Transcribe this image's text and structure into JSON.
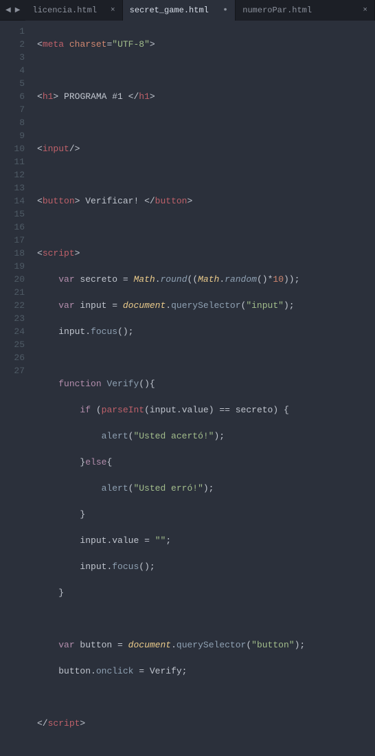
{
  "tabs": [
    {
      "label": "licencia.html",
      "close": "×",
      "active": false,
      "dirty": false
    },
    {
      "label": "secret_game.html",
      "close": "•",
      "active": true,
      "dirty": true
    },
    {
      "label": "numeroPar.html",
      "close": "×",
      "active": false,
      "dirty": false
    }
  ],
  "nav": {
    "back": "◀",
    "forward": "▶",
    "overflow": "⌄"
  },
  "gutter": [
    "1",
    "2",
    "3",
    "4",
    "5",
    "6",
    "7",
    "8",
    "9",
    "10",
    "11",
    "12",
    "13",
    "14",
    "15",
    "16",
    "17",
    "18",
    "19",
    "20",
    "21",
    "22",
    "23",
    "24",
    "25",
    "26",
    "27"
  ],
  "code": {
    "l1": {
      "a": "<",
      "b": "meta",
      "c": " ",
      "d": "charset",
      "e": "=",
      "f": "\"UTF-8\"",
      "g": ">"
    },
    "l3": {
      "a": "<",
      "b": "h1",
      "c": ">",
      "d": " PROGRAMA #1 ",
      "e": "</",
      "f": "h1",
      "g": ">"
    },
    "l5": {
      "a": "<",
      "b": "input",
      "c": "/>"
    },
    "l7": {
      "a": "<",
      "b": "button",
      "c": ">",
      "d": " Verificar! ",
      "e": "</",
      "f": "button",
      "g": ">"
    },
    "l9": {
      "a": "<",
      "b": "script",
      "c": ">"
    },
    "l10": {
      "kw": "var",
      "id": " secreto ",
      "eq": "=",
      "sp": " ",
      "m": "Math",
      "dot": ".",
      "r": "round",
      "p1": "((",
      "m2": "Math",
      "dot2": ".",
      "r2": "random",
      "p2": "()",
      "st": "*",
      "n": "10",
      "p3": "));"
    },
    "l11": {
      "kw": "var",
      "id": " input ",
      "eq": "=",
      "sp": " ",
      "d": "document",
      "dot": ".",
      "q": "querySelector",
      "p1": "(",
      "s": "\"input\"",
      "p2": ");"
    },
    "l12": {
      "id": "input",
      "dot": ".",
      "fn": "focus",
      "p": "();"
    },
    "l14": {
      "kw": "function",
      "sp": " ",
      "fn": "Verify",
      "p": "(){"
    },
    "l15": {
      "kw": "if",
      "sp": " (",
      "pi": "parseInt",
      "p1": "(",
      "id": "input",
      "dot": ".",
      "v": "value",
      "p2": ") ",
      "eq": "==",
      "sp2": " secreto) {"
    },
    "l16": {
      "fn": "alert",
      "p1": "(",
      "s": "\"Usted acertó!\"",
      "p2": ");"
    },
    "l17": {
      "br": "}",
      "kw": "else",
      "br2": "{"
    },
    "l18": {
      "fn": "alert",
      "p1": "(",
      "s": "\"Usted erró!\"",
      "p2": ");"
    },
    "l19": {
      "br": "}"
    },
    "l20": {
      "id": "input",
      "dot": ".",
      "v": "value",
      "sp": " ",
      "eq": "=",
      "sp2": " ",
      "s": "\"\"",
      "p": ";"
    },
    "l21": {
      "id": "input",
      "dot": ".",
      "fn": "focus",
      "p": "();"
    },
    "l22": {
      "br": "}"
    },
    "l24": {
      "kw": "var",
      "id": " button ",
      "eq": "=",
      "sp": " ",
      "d": "document",
      "dot": ".",
      "q": "querySelector",
      "p1": "(",
      "s": "\"button\"",
      "p2": ");"
    },
    "l25": {
      "id": "button",
      "dot": ".",
      "v": "onclick",
      "sp": " ",
      "eq": "=",
      "sp2": " Verify;"
    },
    "l27": {
      "a": "</",
      "b": "script",
      "c": ">"
    }
  }
}
